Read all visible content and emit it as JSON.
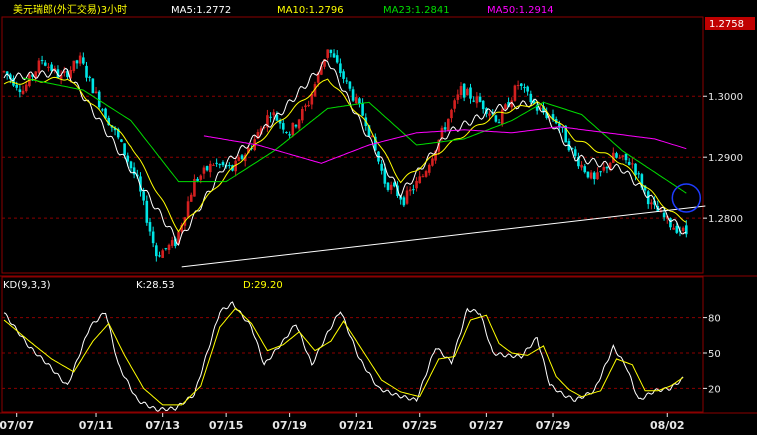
{
  "header": {
    "title": "美元瑞郎(外汇交易)3小时",
    "ma5": "MA5:1.2772",
    "ma10": "MA10:1.2796",
    "ma23": "MA23:1.2841",
    "ma50": "MA50:1.2914",
    "last_price": "1.2758"
  },
  "kd_header": {
    "name": "KD(9,3,3)",
    "k": "K:28.53",
    "d": "D:29.20"
  },
  "colors": {
    "background": "#000000",
    "up": "#d42020",
    "down": "#00e5e5",
    "ma5": "#ffffff",
    "ma10": "#ffff00",
    "ma23": "#00dd00",
    "ma50": "#ff00ff",
    "k": "#ffffff",
    "d": "#ffff00",
    "grid": "#8b0000",
    "trendline": "#ffffff",
    "circle": "#1e3cff"
  },
  "chart_data": [
    {
      "type": "candlestick",
      "title": "美元瑞郎(外汇交易)3小时",
      "ylim": [
        1.271,
        1.313
      ],
      "yticks": [
        1.28,
        1.29,
        1.3
      ],
      "ytick_labels": [
        "1.2800",
        "1.2900",
        "1.3000"
      ],
      "last_price": 1.2758,
      "x_labels": [
        "07/07",
        "07/11",
        "07/13",
        "07/15",
        "07/19",
        "07/21",
        "07/25",
        "07/27",
        "07/29",
        "08/02"
      ],
      "anchors": [
        [
          0,
          1.304
        ],
        [
          6,
          1.301
        ],
        [
          12,
          1.306
        ],
        [
          18,
          1.303
        ],
        [
          24,
          1.306
        ],
        [
          30,
          1.299
        ],
        [
          36,
          1.293
        ],
        [
          42,
          1.286
        ],
        [
          48,
          1.274
        ],
        [
          54,
          1.276
        ],
        [
          60,
          1.286
        ],
        [
          66,
          1.289
        ],
        [
          72,
          1.288
        ],
        [
          78,
          1.292
        ],
        [
          84,
          1.2975
        ],
        [
          90,
          1.294
        ],
        [
          96,
          1.299
        ],
        [
          102,
          1.308
        ],
        [
          108,
          1.302
        ],
        [
          114,
          1.296
        ],
        [
          120,
          1.286
        ],
        [
          126,
          1.283
        ],
        [
          132,
          1.287
        ],
        [
          138,
          1.294
        ],
        [
          144,
          1.301
        ],
        [
          150,
          1.299
        ],
        [
          156,
          1.296
        ],
        [
          162,
          1.302
        ],
        [
          168,
          1.298
        ],
        [
          174,
          1.296
        ],
        [
          180,
          1.29
        ],
        [
          186,
          1.286
        ],
        [
          192,
          1.29
        ],
        [
          198,
          1.289
        ],
        [
          204,
          1.282
        ],
        [
          210,
          1.279
        ],
        [
          215,
          1.2775
        ]
      ],
      "ma_anchors": {
        "MA5": [
          [
            0,
            1.303
          ],
          [
            20,
            1.304
          ],
          [
            40,
            1.288
          ],
          [
            55,
            1.276
          ],
          [
            70,
            1.289
          ],
          [
            85,
            1.296
          ],
          [
            102,
            1.306
          ],
          [
            115,
            1.293
          ],
          [
            125,
            1.284
          ],
          [
            140,
            1.294
          ],
          [
            155,
            1.298
          ],
          [
            168,
            1.299
          ],
          [
            180,
            1.29
          ],
          [
            195,
            1.288
          ],
          [
            210,
            1.28
          ],
          [
            215,
            1.2772
          ]
        ],
        "MA10": [
          [
            0,
            1.302
          ],
          [
            20,
            1.303
          ],
          [
            40,
            1.292
          ],
          [
            55,
            1.278
          ],
          [
            70,
            1.287
          ],
          [
            85,
            1.295
          ],
          [
            102,
            1.303
          ],
          [
            115,
            1.295
          ],
          [
            125,
            1.286
          ],
          [
            140,
            1.292
          ],
          [
            155,
            1.297
          ],
          [
            168,
            1.299
          ],
          [
            180,
            1.293
          ],
          [
            195,
            1.289
          ],
          [
            210,
            1.281
          ],
          [
            215,
            1.2796
          ]
        ],
        "MA23": [
          [
            6,
            1.303
          ],
          [
            25,
            1.301
          ],
          [
            40,
            1.296
          ],
          [
            55,
            1.286
          ],
          [
            70,
            1.286
          ],
          [
            85,
            1.291
          ],
          [
            102,
            1.298
          ],
          [
            115,
            1.299
          ],
          [
            130,
            1.292
          ],
          [
            145,
            1.293
          ],
          [
            160,
            1.296
          ],
          [
            170,
            1.299
          ],
          [
            182,
            1.297
          ],
          [
            195,
            1.291
          ],
          [
            215,
            1.2841
          ]
        ],
        "MA50": [
          [
            63,
            1.2935
          ],
          [
            80,
            1.292
          ],
          [
            100,
            1.289
          ],
          [
            115,
            1.292
          ],
          [
            130,
            1.294
          ],
          [
            145,
            1.2945
          ],
          [
            160,
            1.294
          ],
          [
            175,
            1.295
          ],
          [
            190,
            1.294
          ],
          [
            205,
            1.293
          ],
          [
            215,
            1.2914
          ]
        ]
      },
      "trendline": [
        [
          56,
          1.272
        ],
        [
          221,
          1.282
        ]
      ],
      "annotation": {
        "type": "circle",
        "x": 215,
        "y": 1.2833
      }
    },
    {
      "type": "line",
      "title": "KD(9,3,3)",
      "ylim": [
        0,
        100
      ],
      "yticks": [
        20,
        50,
        80
      ],
      "series": [
        {
          "name": "K",
          "value_label": "K:28.53",
          "anchors": [
            [
              0,
              84
            ],
            [
              8,
              55
            ],
            [
              14,
              40
            ],
            [
              20,
              22
            ],
            [
              27,
              72
            ],
            [
              32,
              85
            ],
            [
              36,
              40
            ],
            [
              42,
              10
            ],
            [
              48,
              2
            ],
            [
              54,
              3
            ],
            [
              60,
              15
            ],
            [
              68,
              85
            ],
            [
              72,
              92
            ],
            [
              78,
              72
            ],
            [
              82,
              40
            ],
            [
              88,
              60
            ],
            [
              92,
              75
            ],
            [
              97,
              40
            ],
            [
              102,
              67
            ],
            [
              106,
              86
            ],
            [
              112,
              45
            ],
            [
              118,
              20
            ],
            [
              124,
              14
            ],
            [
              130,
              10
            ],
            [
              136,
              55
            ],
            [
              141,
              42
            ],
            [
              146,
              87
            ],
            [
              150,
              84
            ],
            [
              154,
              50
            ],
            [
              158,
              48
            ],
            [
              163,
              47
            ],
            [
              168,
              63
            ],
            [
              172,
              23
            ],
            [
              176,
              15
            ],
            [
              180,
              10
            ],
            [
              186,
              18
            ],
            [
              192,
              55
            ],
            [
              196,
              39
            ],
            [
              200,
              10
            ],
            [
              205,
              18
            ],
            [
              210,
              20
            ],
            [
              214,
              28.5
            ]
          ]
        },
        {
          "name": "D",
          "value_label": "D:29.20",
          "anchors": [
            [
              0,
              78
            ],
            [
              8,
              60
            ],
            [
              15,
              45
            ],
            [
              22,
              34
            ],
            [
              28,
              60
            ],
            [
              33,
              75
            ],
            [
              38,
              48
            ],
            [
              44,
              20
            ],
            [
              50,
              6
            ],
            [
              56,
              6
            ],
            [
              62,
              22
            ],
            [
              68,
              72
            ],
            [
              73,
              88
            ],
            [
              78,
              75
            ],
            [
              83,
              52
            ],
            [
              88,
              57
            ],
            [
              93,
              68
            ],
            [
              98,
              52
            ],
            [
              103,
              60
            ],
            [
              107,
              77
            ],
            [
              113,
              52
            ],
            [
              119,
              27
            ],
            [
              125,
              17
            ],
            [
              131,
              13
            ],
            [
              137,
              45
            ],
            [
              142,
              47
            ],
            [
              147,
              78
            ],
            [
              152,
              82
            ],
            [
              156,
              58
            ],
            [
              160,
              50
            ],
            [
              165,
              48
            ],
            [
              170,
              56
            ],
            [
              174,
              30
            ],
            [
              178,
              19
            ],
            [
              182,
              13
            ],
            [
              188,
              18
            ],
            [
              193,
              45
            ],
            [
              198,
              40
            ],
            [
              202,
              18
            ],
            [
              206,
              18
            ],
            [
              210,
              22
            ],
            [
              214,
              29.2
            ]
          ]
        }
      ]
    }
  ]
}
